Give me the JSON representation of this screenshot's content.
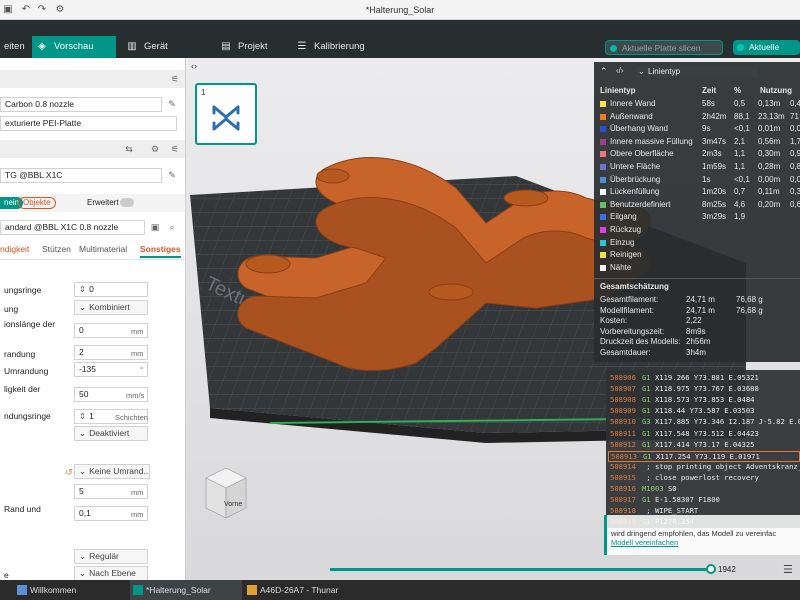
{
  "window": {
    "title": "*Halterung_Solar"
  },
  "toolbar": {
    "tabs": [
      {
        "label": "eiten",
        "icon": "edit-icon"
      },
      {
        "label": "Vorschau",
        "icon": "preview-icon"
      },
      {
        "label": "Gerät",
        "icon": "device-icon"
      },
      {
        "label": "Projekt",
        "icon": "project-icon"
      },
      {
        "label": "Kalibrierung",
        "icon": "calibration-icon"
      }
    ],
    "slice_btn": "Aktuelle Platte slicen",
    "print_btn": "Aktuelle Platte"
  },
  "sidebar": {
    "nozzle": "Carbon 0.8 nozzle",
    "plate": "exturierte PEI-Platte",
    "printer": "TG @BBL X1C",
    "mode_left": "nein",
    "mode_right": "Objekte",
    "advanced": "Erweitert",
    "process": "andard @BBL X1C 0.8 nozzle",
    "tabs": [
      "ndigkeit",
      "Stützen",
      "Multimaterial",
      "Sonstiges"
    ],
    "settings": [
      {
        "label": "ungsringe",
        "value": "0",
        "unit": ""
      },
      {
        "label": "ung",
        "value": "Kombiniert",
        "unit": ""
      },
      {
        "label": "ionslänge der",
        "value": "0",
        "unit": "mm"
      },
      {
        "label": "randung",
        "value": "2",
        "unit": "mm"
      },
      {
        "label": "Umrandung",
        "value": "-135",
        "unit": "°"
      },
      {
        "label": "ligkeit der",
        "value": "50",
        "unit": "mm/s"
      },
      {
        "label": "ndungsringe",
        "value": "1",
        "unit": "Schichten"
      },
      {
        "label": "",
        "value": "Deaktiviert",
        "unit": ""
      },
      {
        "label": "",
        "value": "Keine Umrand...",
        "unit": ""
      },
      {
        "label": "",
        "value": "5",
        "unit": "mm"
      },
      {
        "label": "Rand und",
        "value": "0,1",
        "unit": "mm"
      },
      {
        "label": "",
        "value": "Regulär",
        "unit": ""
      },
      {
        "label": "e",
        "value": "Nach Ebene",
        "unit": ""
      }
    ]
  },
  "viewport": {
    "thumb_number": "1",
    "plate_label": "Textured PEI Plate",
    "cube_label": "Vorne",
    "slider_value": "1942",
    "colors": {
      "model": "#c8642a",
      "plate": "#3a3d40",
      "grid": "#5a5e62",
      "accent": "#009688"
    }
  },
  "legend": {
    "title": "Linientyp",
    "columns": [
      "Linientyp",
      "Zeit",
      "%",
      "Nutzung"
    ],
    "rows": [
      {
        "name": "Innere Wand",
        "color": "#ffe14a",
        "time": "58s",
        "pct": "0,5",
        "use": "0,13m",
        "use2": "0,4"
      },
      {
        "name": "Außenwand",
        "color": "#f07b27",
        "time": "2h42m",
        "pct": "88,1",
        "use": "23,13m",
        "use2": "71"
      },
      {
        "name": "Überhang Wand",
        "color": "#2b4ed6",
        "time": "9s",
        "pct": "<0,1",
        "use": "0,01m",
        "use2": "0,0"
      },
      {
        "name": "Innere massive Füllung",
        "color": "#a63d8c",
        "time": "3m47s",
        "pct": "2,1",
        "use": "0,56m",
        "use2": "1,7"
      },
      {
        "name": "Obere Oberfläche",
        "color": "#e8787a",
        "time": "2m3s",
        "pct": "1,1",
        "use": "0,30m",
        "use2": "0,9"
      },
      {
        "name": "Untere Fläche",
        "color": "#6f6fd6",
        "time": "1m59s",
        "pct": "1,1",
        "use": "0,28m",
        "use2": "0,8"
      },
      {
        "name": "Überbrückung",
        "color": "#4d8fd6",
        "time": "1s",
        "pct": "<0,1",
        "use": "0,00m",
        "use2": "0,0"
      },
      {
        "name": "Lückenfüllung",
        "color": "#ffffff",
        "time": "1m20s",
        "pct": "0,7",
        "use": "0,11m",
        "use2": "0,3"
      },
      {
        "name": "Benutzerdefiniert",
        "color": "#5ec26a",
        "time": "8m25s",
        "pct": "4,6",
        "use": "0,20m",
        "use2": "0,6"
      },
      {
        "name": "Eilgang",
        "color": "#3a6cf0",
        "time": "3m29s",
        "pct": "1,9",
        "use": "",
        "use2": ""
      },
      {
        "name": "Rückzug",
        "color": "#e040e0",
        "time": "",
        "pct": "",
        "use": "",
        "use2": ""
      },
      {
        "name": "Einzug",
        "color": "#26c6da",
        "time": "",
        "pct": "",
        "use": "",
        "use2": ""
      },
      {
        "name": "Reinigen",
        "color": "#f0e040",
        "time": "",
        "pct": "",
        "use": "",
        "use2": ""
      },
      {
        "name": "Nähte",
        "color": "#f4f4f4",
        "time": "",
        "pct": "",
        "use": "",
        "use2": ""
      }
    ],
    "summary_title": "Gesamtschätzung",
    "summary": [
      {
        "label": "Gesamtfilament:",
        "v1": "24,71 m",
        "v2": "76,68 g"
      },
      {
        "label": "Modellfilament:",
        "v1": "24,71 m",
        "v2": "76,68 g"
      },
      {
        "label": "Kosten:",
        "v1": "2,22",
        "v2": ""
      },
      {
        "label": "Vorbereitungszeit:",
        "v1": "8m9s",
        "v2": ""
      },
      {
        "label": "Druckzeit des Modells:",
        "v1": "2h56m",
        "v2": ""
      },
      {
        "label": "Gesamtdauer:",
        "v1": "3h4m",
        "v2": ""
      }
    ]
  },
  "gcode": [
    {
      "n": "508906",
      "cmd": "G1",
      "args": "X119.266 Y73.881 E.05321"
    },
    {
      "n": "508907",
      "cmd": "G1",
      "args": "X118.975 Y73.767 E.03688"
    },
    {
      "n": "508908",
      "cmd": "G1",
      "args": "X118.573 Y73.853 E.0484"
    },
    {
      "n": "508909",
      "cmd": "G1",
      "args": "X118.44 Y73.587 E.03503"
    },
    {
      "n": "508910",
      "cmd": "G3",
      "args": "X117.885 Y73.346 I2.187 J-5.82 E.0713"
    },
    {
      "n": "508911",
      "cmd": "G1",
      "args": "X117.548 Y73.512 E.04423"
    },
    {
      "n": "508912",
      "cmd": "G1",
      "args": "X117.414 Y73.17 E.04325"
    },
    {
      "n": "508913",
      "cmd": "G1",
      "args": "X117.254 Y73.119 E.01971"
    },
    {
      "n": "508914",
      "cmd": "",
      "args": "; stop printing object Adventskranz_III.stp i"
    },
    {
      "n": "508915",
      "cmd": "",
      "args": "; close powerlost recovery"
    },
    {
      "n": "508916",
      "cmd": "M1003",
      "args": "S0"
    },
    {
      "n": "508917",
      "cmd": "G1",
      "args": "E-1.58307 F1800"
    },
    {
      "n": "508918",
      "cmd": "",
      "args": "; WIPE_START"
    },
    {
      "n": "508919",
      "cmd": "G1",
      "args": "F1270.354"
    }
  ],
  "warning": {
    "text": "wird dringend empfohlen, das Modell zu vereinfac",
    "link": "Modell vereinfachen"
  },
  "taskbar": {
    "items": [
      "Willkommen",
      "*Halterung_Solar",
      "A46D-26A7 - Thunar"
    ]
  }
}
